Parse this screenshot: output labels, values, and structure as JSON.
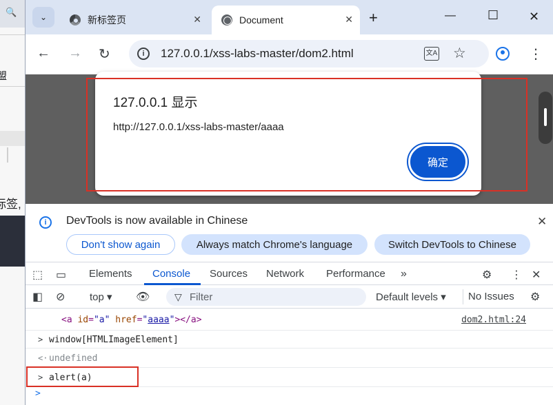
{
  "background_window": {
    "fragments": [
      "盟",
      "标签,"
    ]
  },
  "tabs": [
    {
      "label": "新标签页",
      "active": false
    },
    {
      "label": "Document",
      "active": true
    }
  ],
  "address_bar": {
    "url": "127.0.0.1/xss-labs-master/dom2.html"
  },
  "alert_dialog": {
    "title": "127.0.0.1 显示",
    "message": "http://127.0.0.1/xss-labs-master/aaaa",
    "ok_label": "确定"
  },
  "devtools": {
    "infobar": {
      "message": "DevTools is now available in Chinese",
      "dont_show": "Don't show again",
      "always_match": "Always match Chrome's language",
      "switch": "Switch DevTools to Chinese"
    },
    "tabs": [
      "Elements",
      "Console",
      "Sources",
      "Network",
      "Performance"
    ],
    "active_tab": "Console",
    "console_toolbar": {
      "context": "top",
      "filter_placeholder": "Filter",
      "levels": "Default levels",
      "issues": "No Issues"
    },
    "console_rows": [
      {
        "html": "<a id=\"a\" href=\"aaaa\"></a>",
        "source": "dom2.html:24"
      },
      {
        "command": "window[HTMLImageElement]"
      },
      {
        "result": "undefined"
      },
      {
        "command": "alert(a)"
      }
    ]
  },
  "colors": {
    "accent": "#0b57d0",
    "highlight_box": "#d93025",
    "tabstrip": "#dbe4f3"
  }
}
